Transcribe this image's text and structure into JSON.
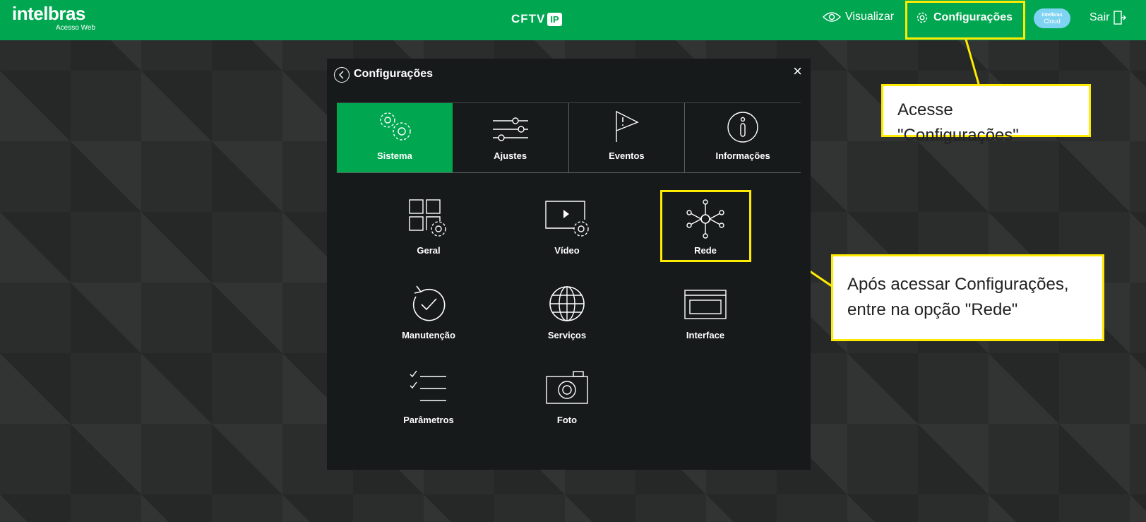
{
  "header": {
    "logo_text": "intelbras",
    "logo_sub": "Acesso Web",
    "product_text": "CFTV",
    "product_badge": "IP",
    "nav": {
      "visualizar": "Visualizar",
      "configuracoes": "Configurações",
      "cloud_line1": "intelbras",
      "cloud_line2": "Cloud",
      "sair": "Sair"
    },
    "colors": {
      "brand": "#00a650",
      "highlight": "#ffeb00"
    }
  },
  "dialog": {
    "title": "Configurações",
    "close": "×",
    "tabs": [
      {
        "label": "Sistema",
        "icon": "gears-icon",
        "active": true
      },
      {
        "label": "Ajustes",
        "icon": "sliders-icon",
        "active": false
      },
      {
        "label": "Eventos",
        "icon": "flag-icon",
        "active": false
      },
      {
        "label": "Informações",
        "icon": "info-icon",
        "active": false
      }
    ],
    "items": [
      {
        "label": "Geral",
        "icon": "grid-gear-icon"
      },
      {
        "label": "Vídeo",
        "icon": "video-gear-icon"
      },
      {
        "label": "Rede",
        "icon": "network-icon"
      },
      {
        "label": "Manutenção",
        "icon": "restore-check-icon"
      },
      {
        "label": "Serviços",
        "icon": "globe-icon"
      },
      {
        "label": "Interface",
        "icon": "window-icon"
      },
      {
        "label": "Parâmetros",
        "icon": "checklist-icon"
      },
      {
        "label": "Foto",
        "icon": "camera-icon"
      }
    ]
  },
  "callouts": {
    "config": "Acesse \"Configurações\"",
    "rede_line1": "Após acessar Configurações,",
    "rede_line2": "entre na opção \"Rede\""
  }
}
